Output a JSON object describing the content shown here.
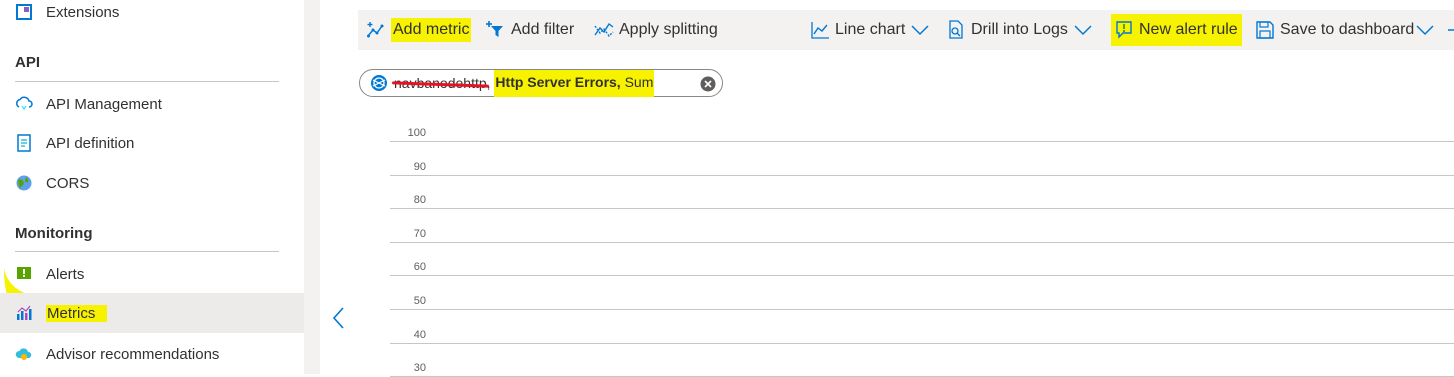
{
  "sidebar": {
    "top_item": {
      "label": "Extensions",
      "icon": "extensions-icon"
    },
    "sections": [
      {
        "title": "API",
        "items": [
          {
            "label": "API Management",
            "icon": "cloud-sync-icon"
          },
          {
            "label": "API definition",
            "icon": "document-icon"
          },
          {
            "label": "CORS",
            "icon": "globe-icon"
          }
        ]
      },
      {
        "title": "Monitoring",
        "items": [
          {
            "label": "Alerts",
            "icon": "alert-icon"
          },
          {
            "label": "Metrics",
            "icon": "metrics-icon",
            "selected": true
          },
          {
            "label": "Advisor recommendations",
            "icon": "advisor-cloud-icon"
          }
        ]
      }
    ]
  },
  "toolbar": {
    "add_metric": "Add metric",
    "add_filter": "Add filter",
    "apply_splitting": "Apply splitting",
    "line_chart": "Line chart",
    "drill_into_logs": "Drill into Logs",
    "new_alert_rule": "New alert rule",
    "save_to_dashboard": "Save to dashboard"
  },
  "metric_pill": {
    "resource": "navbanodehttp",
    "separator": ", ",
    "metric": "Http Server Errors,",
    "aggregation": "Sum"
  },
  "chart_data": {
    "type": "line",
    "y_ticks": [
      "100",
      "90",
      "80",
      "70",
      "60",
      "50",
      "40",
      "30"
    ],
    "ylim": [
      30,
      100
    ],
    "series": []
  },
  "colors": {
    "highlight": "#f6f200",
    "accent": "#0078d4",
    "strike": "#e81123",
    "toolbar_bg": "#f3f2f1",
    "selected_bg": "#edebe9"
  }
}
